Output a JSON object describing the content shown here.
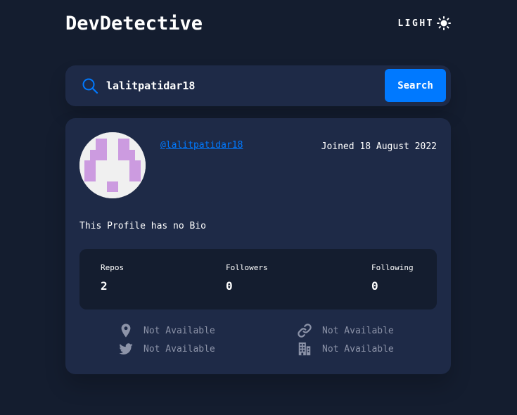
{
  "header": {
    "logo": "DevDetective",
    "theme_label": "LIGHT",
    "theme_icon": "sun-icon"
  },
  "search": {
    "icon": "search-icon",
    "value": "lalitpatidar18",
    "button_label": "Search"
  },
  "profile": {
    "avatar_icon": "identicon-avatar",
    "avatar_color": "#cc9be0",
    "username": "@lalitpatidar18",
    "joined": "Joined 18 August 2022",
    "bio": "This Profile has no Bio",
    "stats": [
      {
        "label": "Repos",
        "value": "2"
      },
      {
        "label": "Followers",
        "value": "0"
      },
      {
        "label": "Following",
        "value": "0"
      }
    ],
    "links": {
      "location": {
        "icon": "location-pin-icon",
        "text": "Not Available"
      },
      "website": {
        "icon": "link-icon",
        "text": "Not Available"
      },
      "twitter": {
        "icon": "twitter-icon",
        "text": "Not Available"
      },
      "company": {
        "icon": "building-icon",
        "text": "Not Available"
      }
    }
  },
  "colors": {
    "background": "#141d2f",
    "card": "#1e2a47",
    "accent": "#0079ff",
    "muted": "#8c93a8"
  }
}
